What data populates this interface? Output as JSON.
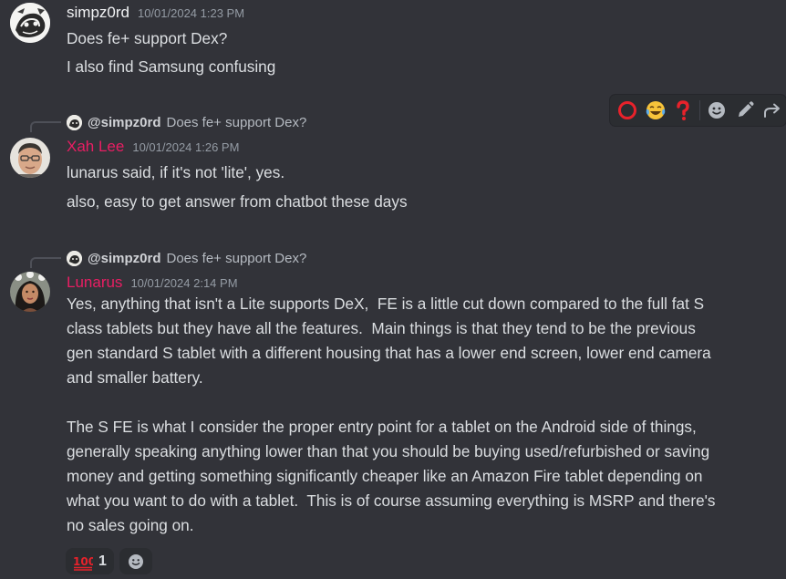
{
  "colors": {
    "background": "#323339",
    "text": "#dbdee1",
    "muted": "#949ba4",
    "role_pink": "#e91e63"
  },
  "messages": [
    {
      "username": "simpz0rd",
      "timestamp": "10/01/2024 1:23 PM",
      "lines": [
        "Does fe+ support Dex?",
        "I also find Samsung confusing"
      ]
    },
    {
      "reply": {
        "name": "@simpz0rd",
        "text": "Does fe+ support Dex?"
      },
      "username": "Xah Lee",
      "timestamp": "10/01/2024 1:26 PM",
      "lines": [
        "lunarus said, if it's not 'lite', yes.",
        "also, easy to get answer from chatbot these days"
      ]
    },
    {
      "reply": {
        "name": "@simpz0rd",
        "text": "Does fe+ support Dex?"
      },
      "username": "Lunarus",
      "timestamp": "10/01/2024 2:14 PM",
      "paragraphs": [
        "Yes, anything that isn't a Lite supports DeX,  FE is a little cut down compared to the full fat S\nclass tablets but they have all the features.  Main things is that they tend to be the previous\ngen standard S tablet with a different housing that has a lower end screen, lower end camera\nand smaller battery.",
        "The S FE is what I consider the proper entry point for a tablet on the Android side of things,\ngenerally speaking anything lower than that you should be buying used/refurbished or saving\nmoney and getting something significantly cheaper like an Amazon Fire tablet depending on\nwhat you want to do with a tablet.  This is of course assuming everything is MSRP and there's\nno sales going on."
      ],
      "reactions": [
        {
          "emoji": "100-emoji",
          "count": "1"
        }
      ]
    }
  ],
  "toolbar": {
    "icons": [
      "red-circle-emoji",
      "joy-emoji",
      "red-question-emoji",
      "add-reaction-icon",
      "edit-icon",
      "reply-icon"
    ]
  }
}
